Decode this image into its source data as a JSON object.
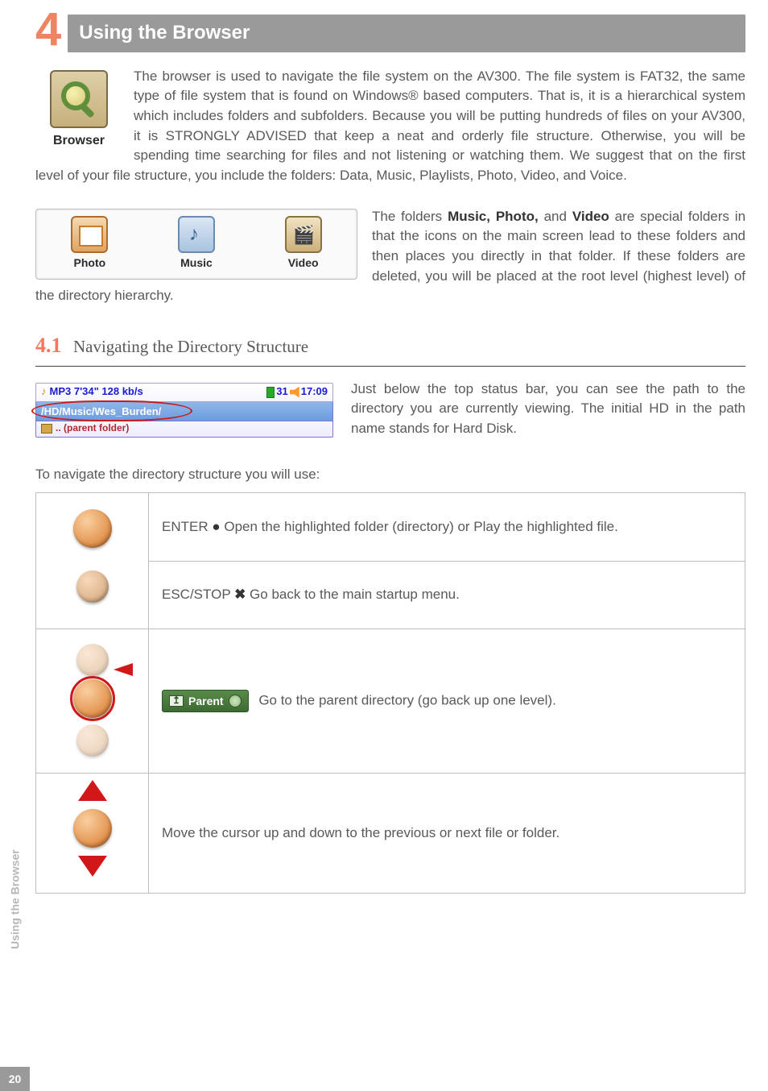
{
  "chapter": {
    "number": "4",
    "title": "Using the Browser"
  },
  "browser_icon_caption": "Browser",
  "intro_text": "The browser is used to navigate the file system on the AV300. The file system is FAT32, the same type of file system that is found on Windows® based computers. That is, it is a hierarchical system which includes folders and subfolders. Because you will be putting hundreds of files on your AV300, it is STRONGLY ADVISED that keep a neat and orderly file structure. Otherwise, you will be spending time searching for files and not listening or watching them. We suggest that on the first level of your file structure, you include the folders: Data, Music, Playlists, Photo, Video, and Voice.",
  "folders": {
    "list": [
      "Photo",
      "Music",
      "Video"
    ],
    "para_pre": "The folders ",
    "para_bold": "Music, Photo,",
    "para_mid": " and ",
    "para_bold2": "Video",
    "para_post": " are special folders in that the icons on the main screen lead to these folders and then places you directly in that folder. If these folders are deleted, you will be placed at the root level (highest level) of the directory hierarchy."
  },
  "section": {
    "number": "4.1",
    "title": "Navigating the Directory Structure"
  },
  "status": {
    "left": "MP3 7'34\" 128 kb/s",
    "battery_pct": "31",
    "clock": "17:09",
    "path": "/HD/Music/Wes_Burden/",
    "parent": ".. (parent folder)"
  },
  "status_para": "Just below the top status bar, you can see the path to the directory you are currently viewing. The initial HD in the path name stands for Hard Disk.",
  "controls_intro": "To navigate the directory structure you will use:",
  "controls": {
    "enter_label": "ENTER ",
    "enter_symbol": "●",
    "enter_text": " Open the highlighted folder (directory) or Play the highlighted file.",
    "esc_label": "ESC/STOP ",
    "esc_symbol": "✖",
    "esc_text": " Go back to the main startup menu.",
    "parent_chip": "Parent",
    "parent_text": " Go to the parent directory (go back up one level).",
    "updown_text": "Move the cursor up and down to the previous or next file or folder."
  },
  "sidebar": {
    "label": "Using the Browser",
    "page": "20"
  }
}
